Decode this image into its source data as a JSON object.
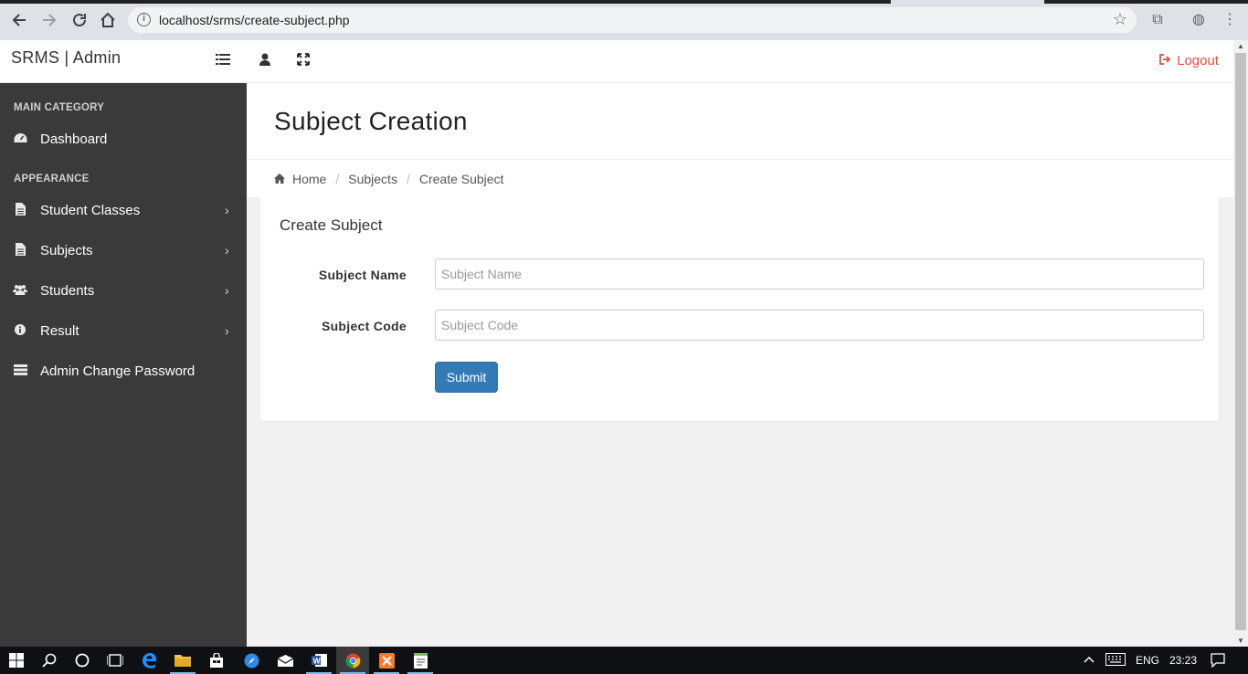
{
  "browser": {
    "url": "localhost/srms/create-subject.php"
  },
  "navbar": {
    "brand": "SRMS | Admin",
    "logout_label": "Logout",
    "icons": [
      "menu-toggle-icon",
      "user-icon",
      "fullscreen-icon"
    ]
  },
  "sidebar": {
    "categories": [
      "MAIN CATEGORY",
      "APPEARANCE"
    ],
    "items": [
      {
        "label": "Dashboard",
        "icon": "dashboard-icon"
      },
      {
        "label": "Student Classes",
        "icon": "file-icon"
      },
      {
        "label": "Subjects",
        "icon": "file-icon"
      },
      {
        "label": "Students",
        "icon": "users-icon"
      },
      {
        "label": "Result",
        "icon": "info-icon"
      },
      {
        "label": "Admin Change Password",
        "icon": "server-icon"
      }
    ]
  },
  "header": {
    "title": "Subject Creation"
  },
  "breadcrumb": {
    "home": "Home",
    "subjects": "Subjects",
    "current": "Create Subject"
  },
  "form": {
    "title": "Create Subject",
    "subject_name_label": "Subject Name",
    "subject_name_placeholder": "Subject Name",
    "subject_code_label": "Subject Code",
    "subject_code_placeholder": "Subject Code",
    "submit_label": "Submit"
  },
  "taskbar": {
    "language": "ENG",
    "time": "23:23"
  },
  "colors": {
    "sidebar_bg": "#3a3a3a",
    "logout": "#e74c3c",
    "primary_button": "#337ab7"
  }
}
